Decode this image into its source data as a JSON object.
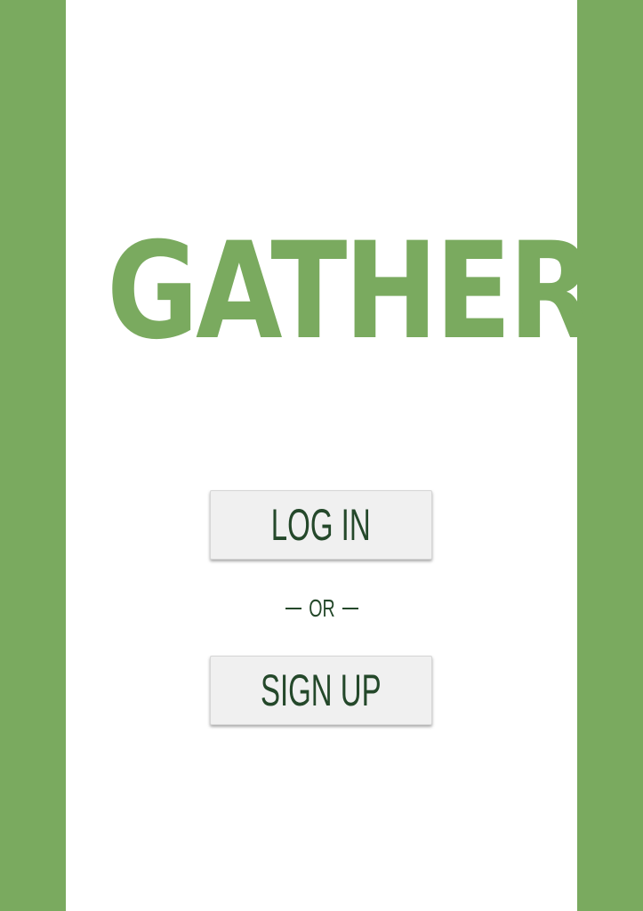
{
  "app": {
    "logo_text": "GATHER"
  },
  "auth": {
    "login_label": "LOG IN",
    "divider_label": "OR",
    "signup_label": "SIGN UP"
  },
  "colors": {
    "brand_green": "#7aaa5f",
    "button_text": "#24482a",
    "button_bg": "#f0f0f0",
    "background": "#ffffff"
  }
}
